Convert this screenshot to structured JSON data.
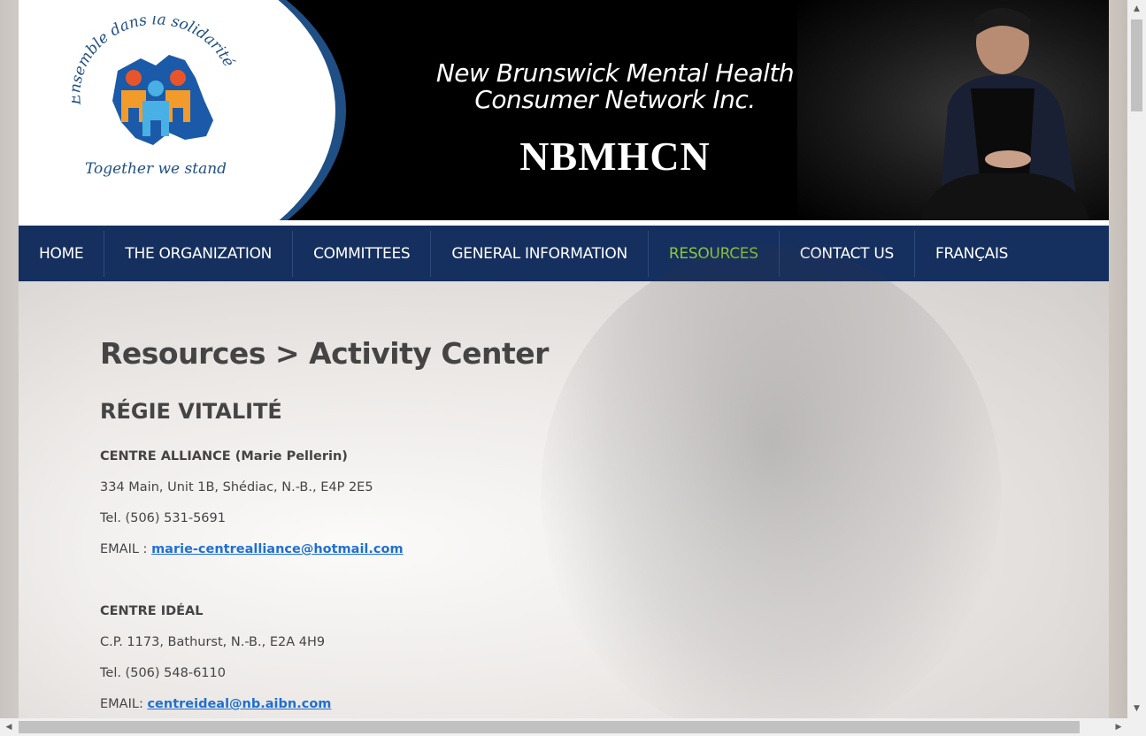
{
  "header": {
    "logo_top_text": "Ensemble dans la solidarité",
    "logo_bottom_text": "Together we stand",
    "title_line1": "New Brunswick Mental Health",
    "title_line2": "Consumer Network Inc.",
    "abbreviation": "NBMHCN"
  },
  "nav": {
    "items": [
      {
        "label": "HOME"
      },
      {
        "label": "THE ORGANIZATION"
      },
      {
        "label": "COMMITTEES"
      },
      {
        "label": "GENERAL INFORMATION"
      },
      {
        "label": "RESOURCES"
      },
      {
        "label": "CONTACT US"
      },
      {
        "label": "FRANÇAIS"
      }
    ],
    "active_color": "#8dc63f",
    "background_color": "#152f5e"
  },
  "content": {
    "breadcrumb": "Resources > Activity Center",
    "region": "RÉGIE VITALITÉ",
    "entries": [
      {
        "name": "CENTRE ALLIANCE (Marie Pellerin)",
        "address": "334 Main, Unit 1B, Shédiac, N.-B., E4P 2E5",
        "tel": "Tel. (506) 531-5691",
        "email_label": "EMAIL : ",
        "email": "marie-centrealliance@hotmail.com"
      },
      {
        "name": "CENTRE IDÉAL",
        "address": "C.P. 1173, Bathurst, N.-B., E2A 4H9",
        "tel": "Tel. (506) 548-6110",
        "email_label": "EMAIL: ",
        "email": "centreideal@nb.aibn.com"
      }
    ],
    "link_color": "#1f6fd1"
  }
}
